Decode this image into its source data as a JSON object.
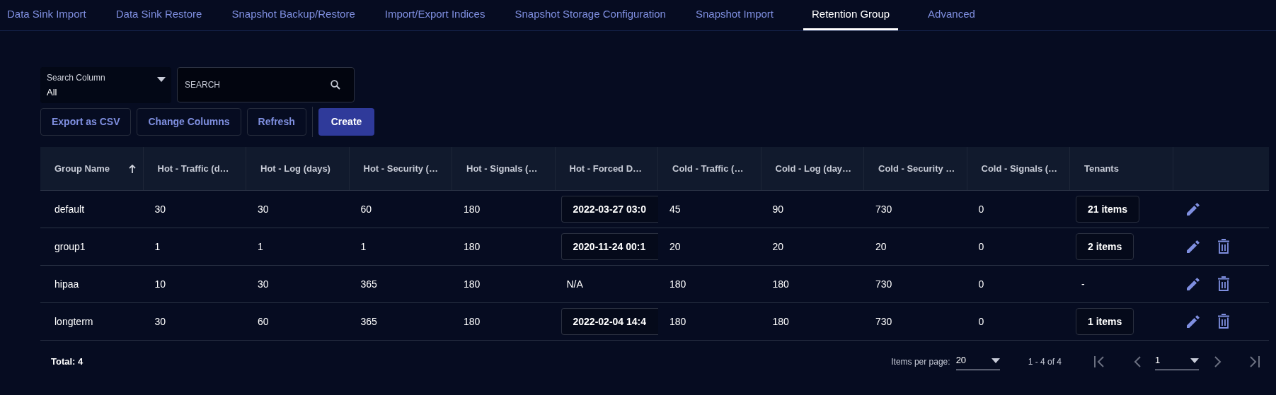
{
  "tabs": [
    {
      "label": "Data Sink Import",
      "selected": false
    },
    {
      "label": "Data Sink Restore",
      "selected": false
    },
    {
      "label": "Snapshot Backup/Restore",
      "selected": false
    },
    {
      "label": "Import/Export Indices",
      "selected": false
    },
    {
      "label": "Snapshot Storage Configuration",
      "selected": false
    },
    {
      "label": "Snapshot Import",
      "selected": false
    },
    {
      "label": "Retention Group",
      "selected": true
    },
    {
      "label": "Advanced",
      "selected": false
    }
  ],
  "search_column": {
    "label": "Search Column",
    "value": "All"
  },
  "search": {
    "placeholder": "SEARCH"
  },
  "buttons": [
    {
      "label": "Export as CSV",
      "kind": "outline"
    },
    {
      "label": "Change Columns",
      "kind": "outline"
    },
    {
      "label": "Refresh",
      "kind": "outline"
    },
    {
      "label": "Create",
      "kind": "primary"
    }
  ],
  "table": {
    "columns": [
      {
        "label": "Group Name",
        "sorted": true
      },
      {
        "label": "Hot - Traffic (d…",
        "sorted": false
      },
      {
        "label": "Hot - Log (days)",
        "sorted": false
      },
      {
        "label": "Hot - Security (…",
        "sorted": false
      },
      {
        "label": "Hot - Signals (…",
        "sorted": false
      },
      {
        "label": "Hot - Forced D…",
        "sorted": false
      },
      {
        "label": "Cold - Traffic (…",
        "sorted": false
      },
      {
        "label": "Cold - Log (day…",
        "sorted": false
      },
      {
        "label": "Cold - Security …",
        "sorted": false
      },
      {
        "label": "Cold - Signals (…",
        "sorted": false
      },
      {
        "label": "Tenants",
        "sorted": false
      }
    ],
    "rows": [
      {
        "cells": [
          {
            "kind": "text",
            "text": "default"
          },
          {
            "kind": "text",
            "text": "30"
          },
          {
            "kind": "text",
            "text": "30"
          },
          {
            "kind": "text",
            "text": "60"
          },
          {
            "kind": "text",
            "text": "180"
          },
          {
            "kind": "date",
            "text": "2022-03-27 03:0"
          },
          {
            "kind": "text",
            "text": "45"
          },
          {
            "kind": "text",
            "text": "90"
          },
          {
            "kind": "text",
            "text": "730"
          },
          {
            "kind": "text",
            "text": "0"
          },
          {
            "kind": "chip",
            "text": "21 items"
          }
        ],
        "editable": true,
        "deletable": false
      },
      {
        "cells": [
          {
            "kind": "text",
            "text": "group1"
          },
          {
            "kind": "text",
            "text": "1"
          },
          {
            "kind": "text",
            "text": "1"
          },
          {
            "kind": "text",
            "text": "1"
          },
          {
            "kind": "text",
            "text": "180"
          },
          {
            "kind": "date",
            "text": "2020-11-24 00:1"
          },
          {
            "kind": "text",
            "text": "20"
          },
          {
            "kind": "text",
            "text": "20"
          },
          {
            "kind": "text",
            "text": "20"
          },
          {
            "kind": "text",
            "text": "0"
          },
          {
            "kind": "chip",
            "text": "2 items"
          }
        ],
        "editable": true,
        "deletable": true
      },
      {
        "cells": [
          {
            "kind": "text",
            "text": "hipaa"
          },
          {
            "kind": "text",
            "text": "10"
          },
          {
            "kind": "text",
            "text": "30"
          },
          {
            "kind": "text",
            "text": "365"
          },
          {
            "kind": "text",
            "text": "180"
          },
          {
            "kind": "text",
            "text": "N/A"
          },
          {
            "kind": "text",
            "text": "180"
          },
          {
            "kind": "text",
            "text": "180"
          },
          {
            "kind": "text",
            "text": "730"
          },
          {
            "kind": "text",
            "text": "0"
          },
          {
            "kind": "text",
            "text": "-"
          }
        ],
        "editable": true,
        "deletable": true
      },
      {
        "cells": [
          {
            "kind": "text",
            "text": "longterm"
          },
          {
            "kind": "text",
            "text": "30"
          },
          {
            "kind": "text",
            "text": "60"
          },
          {
            "kind": "text",
            "text": "365"
          },
          {
            "kind": "text",
            "text": "180"
          },
          {
            "kind": "date",
            "text": "2022-02-04 14:4"
          },
          {
            "kind": "text",
            "text": "180"
          },
          {
            "kind": "text",
            "text": "180"
          },
          {
            "kind": "text",
            "text": "730"
          },
          {
            "kind": "text",
            "text": "0"
          },
          {
            "kind": "chip",
            "text": "1 items"
          }
        ],
        "editable": true,
        "deletable": true
      }
    ]
  },
  "footer": {
    "total": "Total: 4",
    "items_per_page_label": "Items per page:",
    "items_per_page": "20",
    "range": "1 - 4 of 4",
    "page": "1"
  }
}
